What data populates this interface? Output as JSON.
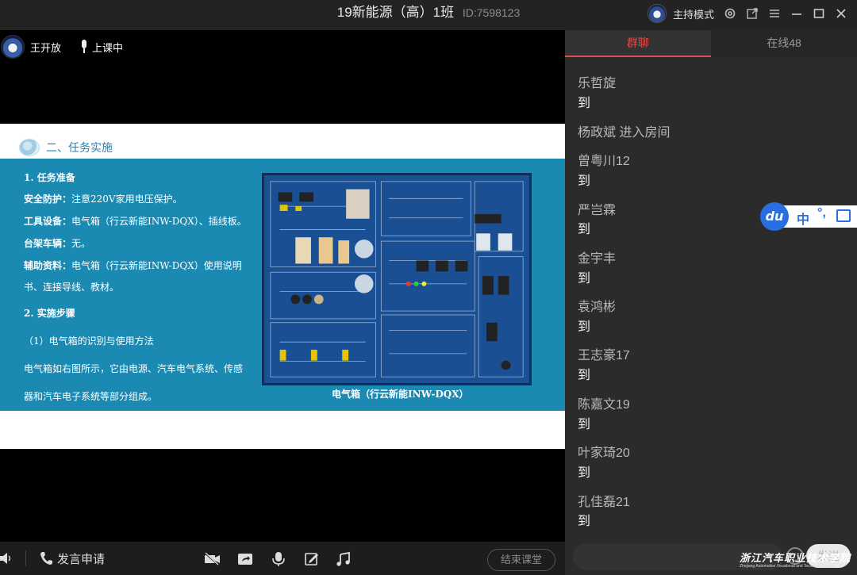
{
  "window": {
    "title": "19新能源（高）1班",
    "room_id": "ID:7598123",
    "host_mode": "主持模式"
  },
  "presenter": {
    "name": "王开放",
    "status": "上课中"
  },
  "slide": {
    "heading": "二、任务实施",
    "lines": [
      {
        "bold": "1. 任务准备",
        "text": ""
      },
      {
        "bold": "安全防护：",
        "text": "注意220V家用电压保护。"
      },
      {
        "bold": "工具设备：",
        "text": "电气箱（行云新能INW-DQX）、插线板。"
      },
      {
        "bold": "台架车辆：",
        "text": "无。"
      },
      {
        "bold": "辅助资料：",
        "text": "电气箱（行云新能INW-DQX）使用说明"
      },
      {
        "bold": "",
        "text": "书、连接导线、教材。"
      },
      {
        "bold": "2. 实施步骤",
        "text": ""
      },
      {
        "bold": "",
        "text": "（1）电气箱的识别与使用方法"
      },
      {
        "bold": "",
        "text": "电气箱如右图所示，它由电源、汽车电气系统、传感"
      },
      {
        "bold": "",
        "text": "器和汽车电子系统等部分组成。"
      }
    ],
    "caption": "电气箱（行云新能INW-DQX）"
  },
  "bottombar": {
    "apply_speak": "发言申请",
    "end_class": "结束课堂",
    "tools": [
      "video-off-icon",
      "screen-share-icon",
      "microphone-icon",
      "edit-note-icon",
      "music-icon"
    ]
  },
  "panel": {
    "tabs": [
      {
        "label": "群聊",
        "active": true
      },
      {
        "label": "在线48",
        "active": false
      }
    ],
    "messages": [
      {
        "name": "乐哲旋",
        "text": "到"
      },
      {
        "name": "杨政斌 进入房间",
        "text": ""
      },
      {
        "name": "曾粤川12",
        "text": "到"
      },
      {
        "name": "严岂霖",
        "text": "到"
      },
      {
        "name": "金宇丰",
        "text": "到"
      },
      {
        "name": "袁鸿彬",
        "text": "到"
      },
      {
        "name": " 王志豪17",
        "text": "到"
      },
      {
        "name": "陈嘉文19",
        "text": "到"
      },
      {
        "name": "叶家琦20",
        "text": "到"
      },
      {
        "name": "孔佳磊21",
        "text": "到"
      }
    ],
    "send_label": "发送"
  },
  "input_widget": {
    "logo": "du",
    "lang": "中"
  },
  "watermark": {
    "cn": "浙江汽车职业技术学院",
    "en": "Zhejiang Automotive Vocational and Technical College"
  },
  "colors": {
    "accent_red": "#e14b4b",
    "slide_band": "#1b8ab3",
    "heading_blue": "#2a7fb6",
    "du_blue": "#2a6fe0"
  }
}
